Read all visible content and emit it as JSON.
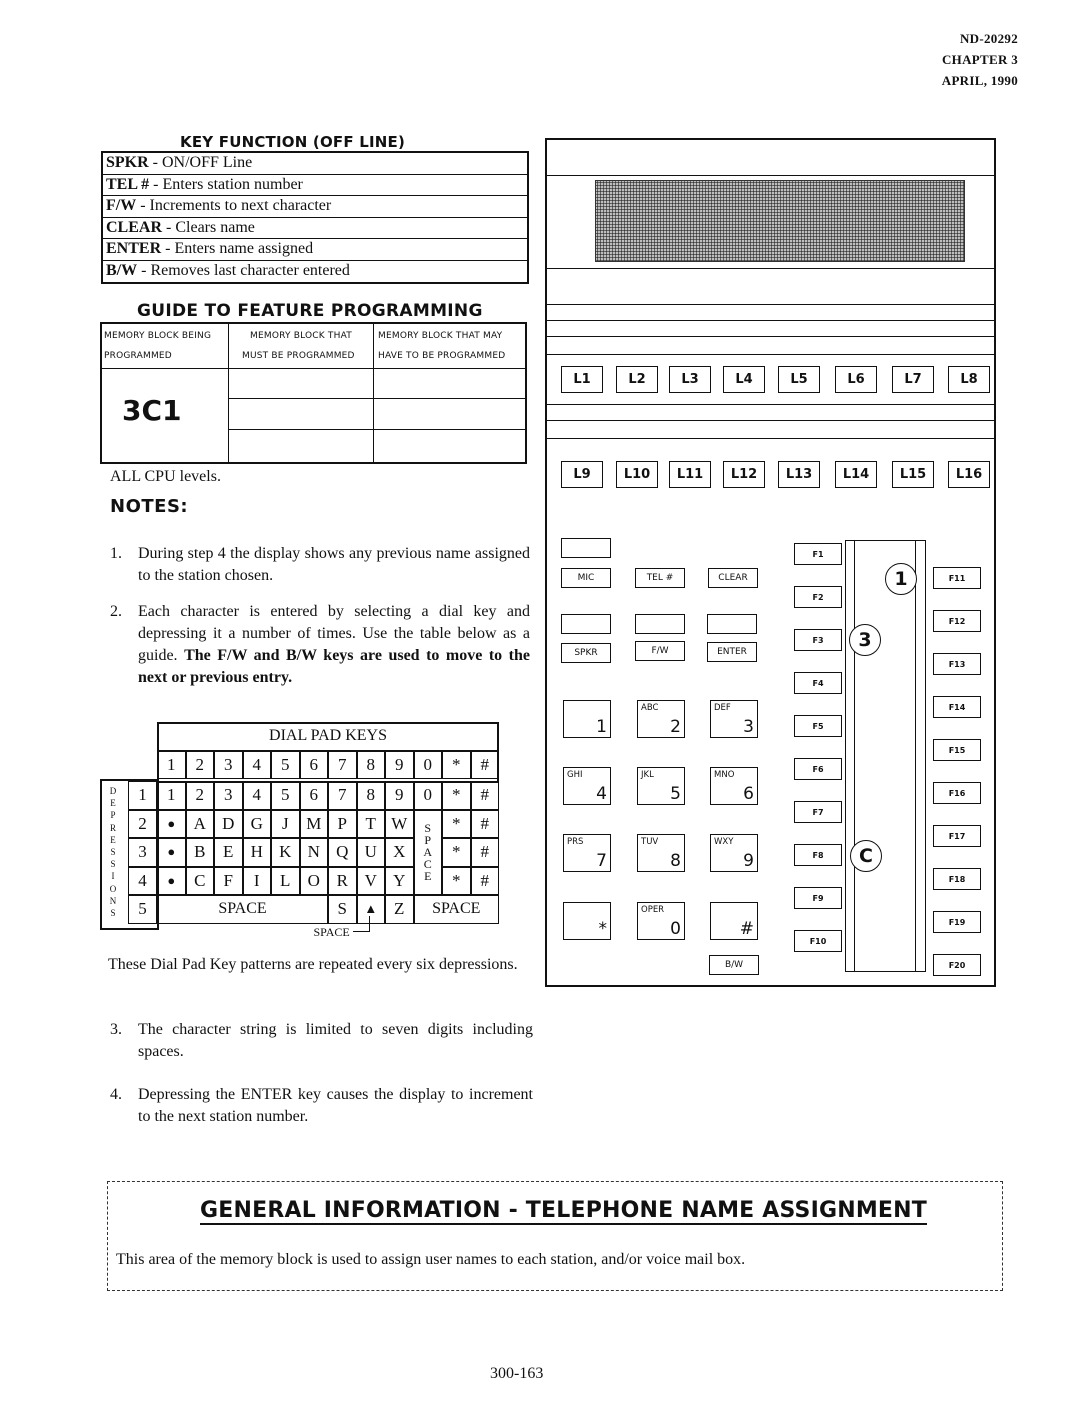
{
  "header": {
    "doc_number": "ND-20292",
    "chapter": "CHAPTER 3",
    "date": "APRIL, 1990"
  },
  "key_function": {
    "title": "KEY FUNCTION (OFF LINE)",
    "rows": [
      {
        "key": "SPKR",
        "desc": " -  ON/OFF Line"
      },
      {
        "key": "TEL #",
        "desc": " - Enters station  number"
      },
      {
        "key": "F/W",
        "desc": " - Increments to next character"
      },
      {
        "key": "CLEAR",
        "desc": " - Clears name"
      },
      {
        "key": "ENTER",
        "desc": " - Enters name assigned"
      },
      {
        "key": "B/W",
        "desc": " - Removes last character entered"
      }
    ]
  },
  "guide": {
    "title": "GUIDE TO FEATURE PROGRAMMING",
    "col1_line1": "MEMORY BLOCK BEING",
    "col1_line2": "PROGRAMMED",
    "col2_line1": "MEMORY BLOCK THAT",
    "col2_line2": "MUST BE PROGRAMMED",
    "col3_line1": "MEMORY BLOCK THAT MAY",
    "col3_line2": "HAVE TO BE PROGRAMMED",
    "block": "3C1"
  },
  "cpu_levels": "ALL CPU levels.",
  "notes_title": "NOTES:",
  "notes": {
    "n1_num": "1.",
    "n1": "During step 4 the display shows any previous name assigned to the station chosen.",
    "n2_num": "2.",
    "n2_plain": "Each character is entered by selecting a dial key and depressing it a number of  times.  Use the table below as a guide. ",
    "n2_bold": "The F/W and B/W keys are used to move to the next or previous entry.",
    "pattern_note": "These Dial Pad Key patterns are repeated every six depressions.",
    "n3_num": "3.",
    "n3": "The character string is limited to seven digits including spaces.",
    "n4_num": "4.",
    "n4": "Depressing the ENTER key causes the display to increment to the next station number."
  },
  "dial_table": {
    "title": "DIAL PAD KEYS",
    "side_label": "DEPRESSIONS",
    "keys": [
      "1",
      "2",
      "3",
      "4",
      "5",
      "6",
      "7",
      "8",
      "9",
      "0",
      "*",
      "#"
    ],
    "rows": [
      {
        "n": "1",
        "cells": [
          "1",
          "2",
          "3",
          "4",
          "5",
          "6",
          "7",
          "8",
          "9",
          "0",
          "*",
          "#"
        ]
      },
      {
        "n": "2",
        "cells": [
          "●",
          "A",
          "D",
          "G",
          "J",
          "M",
          "P",
          "T",
          "W",
          "",
          "*",
          "#"
        ]
      },
      {
        "n": "3",
        "cells": [
          "●",
          "B",
          "E",
          "H",
          "K",
          "N",
          "Q",
          "U",
          "X",
          "",
          "*",
          "#"
        ]
      },
      {
        "n": "4",
        "cells": [
          "●",
          "C",
          "F",
          "I",
          "L",
          "O",
          "R",
          "V",
          "Y",
          "",
          "*",
          "#"
        ]
      }
    ],
    "zero_col_space": "SPACE",
    "row5_n": "5",
    "row5_space": "SPACE",
    "row5_s": "S",
    "row5_z": "Z",
    "row5_space_right": "SPACE",
    "arrow_label": "SPACE"
  },
  "phone": {
    "line_keys_row1": [
      "L1",
      "L2",
      "L3",
      "L4",
      "L5",
      "L6",
      "L7",
      "L8"
    ],
    "line_keys_row2": [
      "L9",
      "L10",
      "L11",
      "L12",
      "L13",
      "L14",
      "L15",
      "L16"
    ],
    "mic": "MIC",
    "tel": "TEL #",
    "clear": "CLEAR",
    "spkr": "SPKR",
    "fw": "F/W",
    "enter": "ENTER",
    "bw": "B/W",
    "dial": [
      {
        "sub": "",
        "num": "1"
      },
      {
        "sub": "ABC",
        "num": "2"
      },
      {
        "sub": "DEF",
        "num": "3"
      },
      {
        "sub": "GHI",
        "num": "4"
      },
      {
        "sub": "JKL",
        "num": "5"
      },
      {
        "sub": "MNO",
        "num": "6"
      },
      {
        "sub": "PRS",
        "num": "7"
      },
      {
        "sub": "TUV",
        "num": "8"
      },
      {
        "sub": "WXY",
        "num": "9"
      },
      {
        "sub": "",
        "num": "*"
      },
      {
        "sub": "OPER",
        "num": "0"
      },
      {
        "sub": "",
        "num": "#"
      }
    ],
    "f_left": [
      "F1",
      "F2",
      "F3",
      "F4",
      "F5",
      "F6",
      "F7",
      "F8",
      "F9",
      "F10"
    ],
    "f_right": [
      "F11",
      "F12",
      "F13",
      "F14",
      "F15",
      "F16",
      "F17",
      "F18",
      "F19",
      "F20"
    ],
    "callouts": [
      "1",
      "3",
      "C"
    ]
  },
  "general": {
    "title": "GENERAL INFORMATION  -  TELEPHONE  NAME  ASSIGNMENT",
    "text": "This area of the memory block is used to assign user names to each station, and/or voice mail box."
  },
  "page_number": "300-163"
}
